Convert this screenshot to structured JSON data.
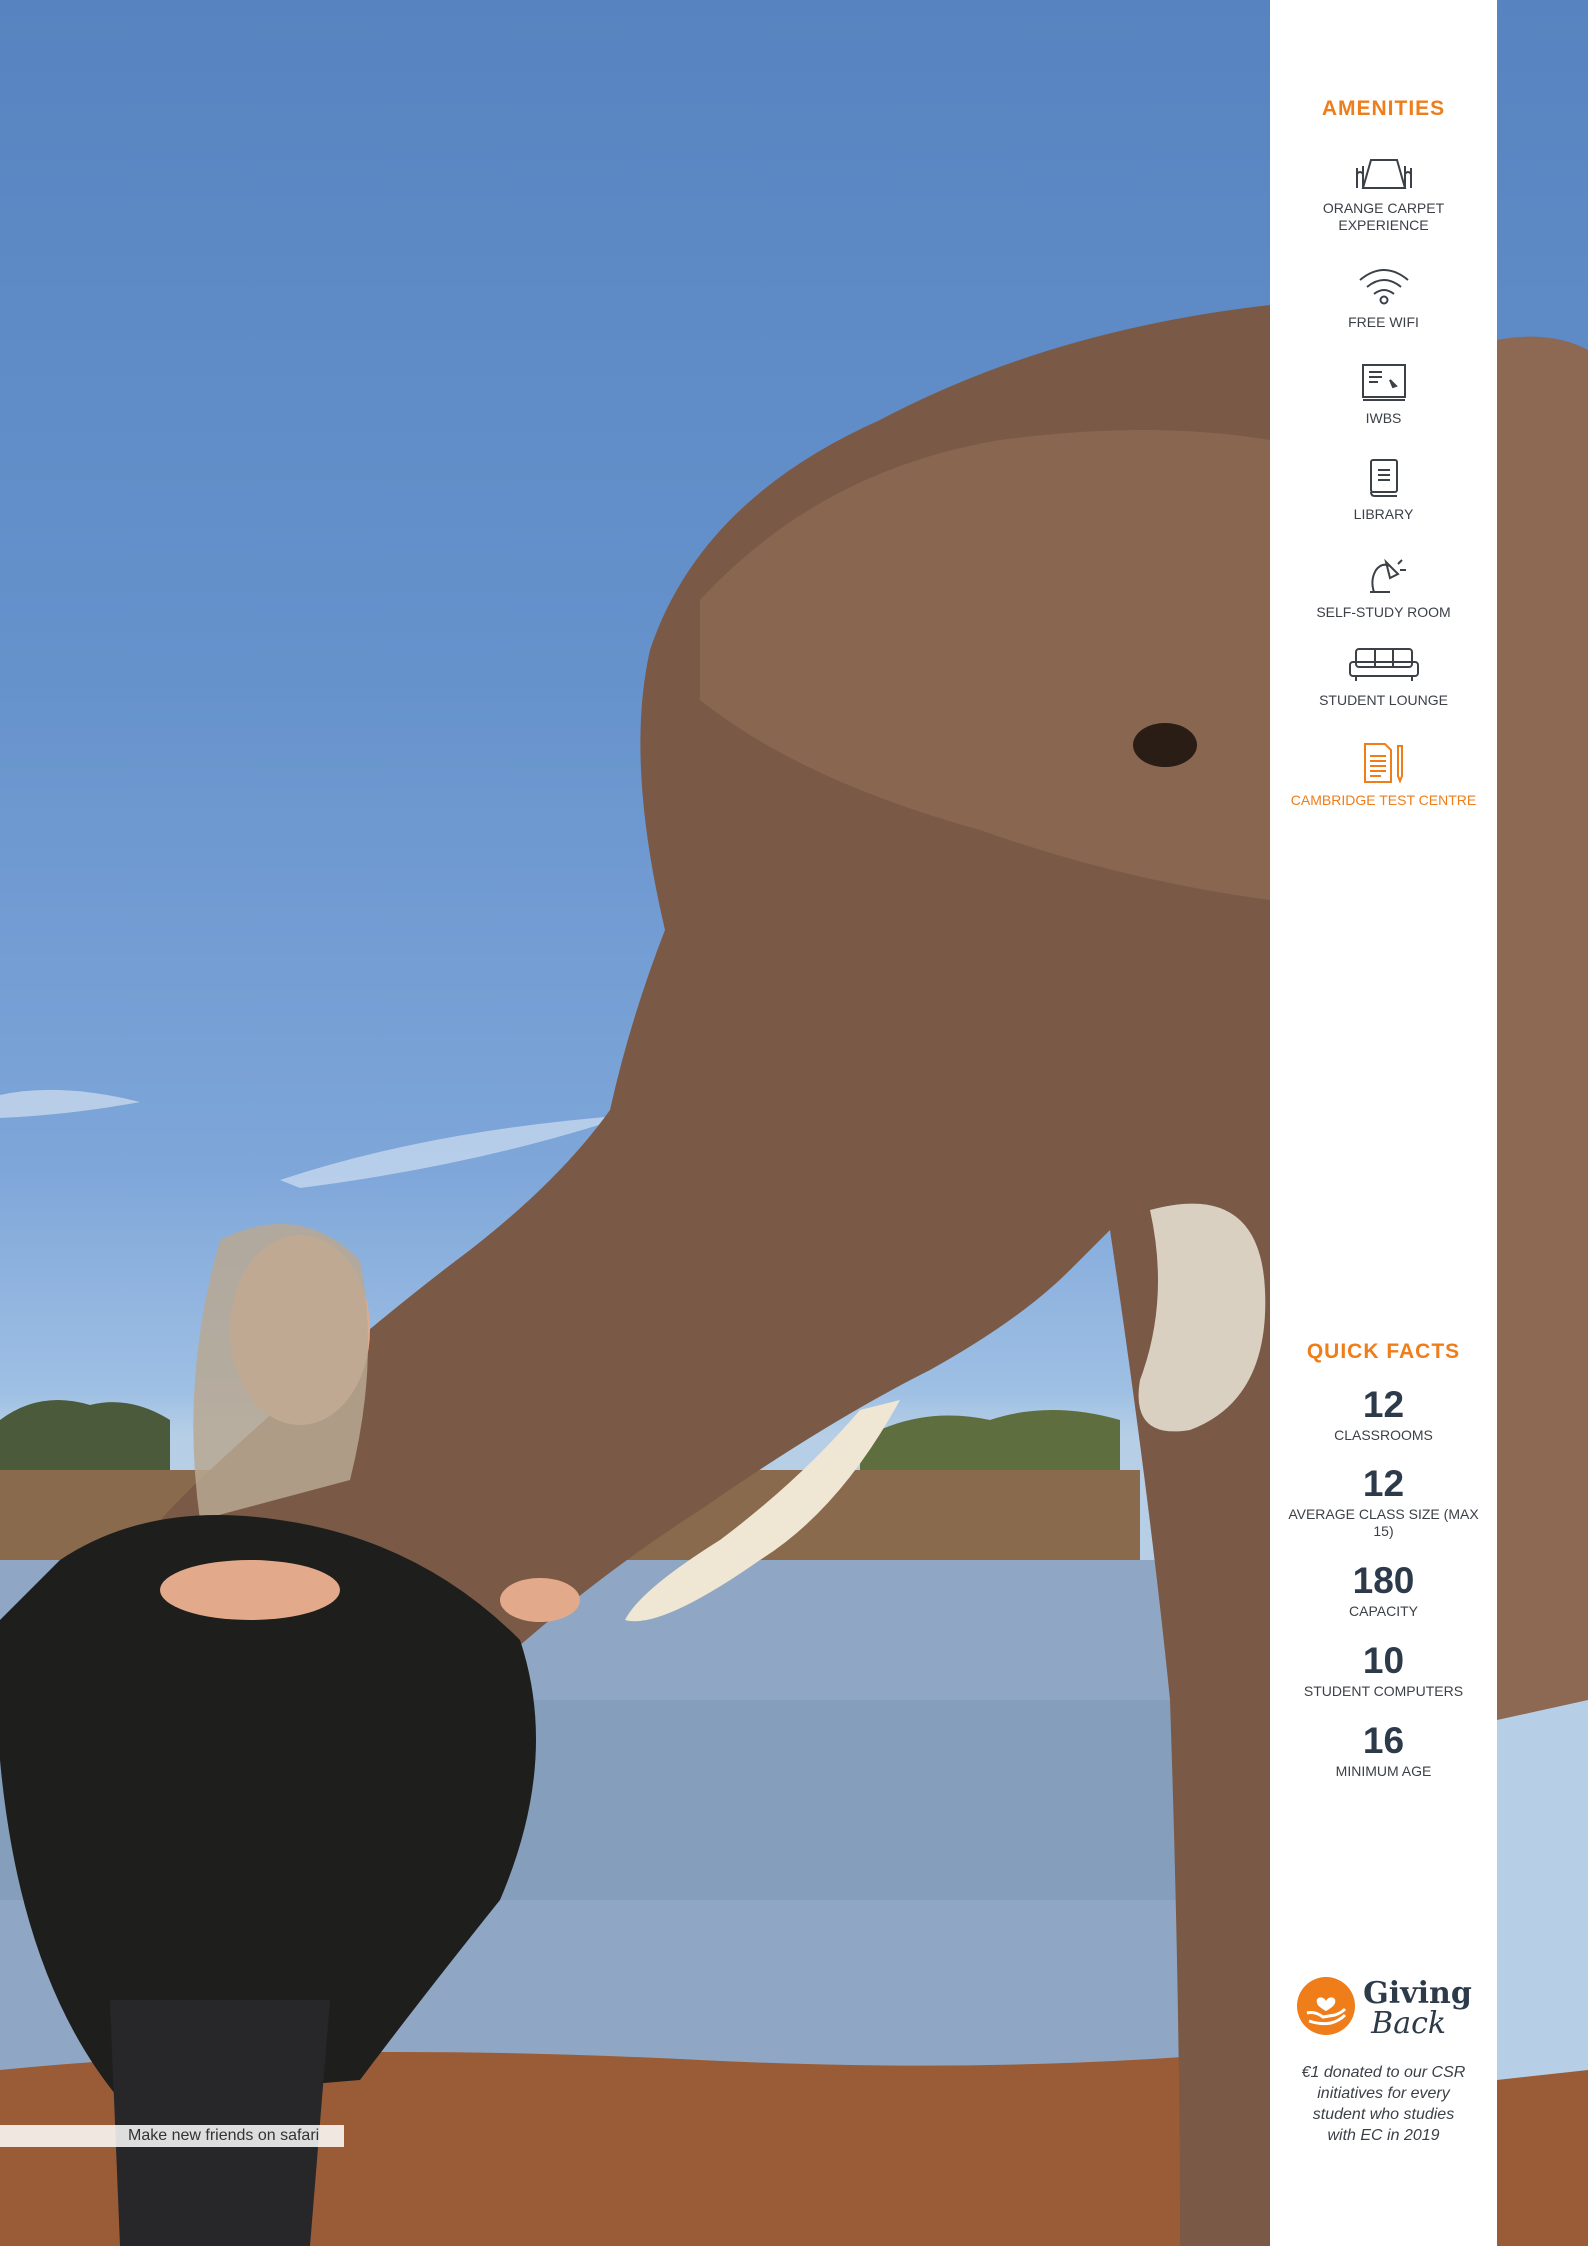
{
  "photo": {
    "subject": "elephant-and-woman-photo"
  },
  "caption": "Make new friends on safari",
  "amenities": {
    "title": "AMENITIES",
    "items": [
      {
        "label": "ORANGE CARPET EXPERIENCE",
        "icon": "orange-carpet-icon"
      },
      {
        "label": "FREE WIFI",
        "icon": "wifi-icon"
      },
      {
        "label": "IWBS",
        "icon": "whiteboard-icon"
      },
      {
        "label": "LIBRARY",
        "icon": "book-icon"
      },
      {
        "label": "SELF-STUDY ROOM",
        "icon": "desk-lamp-icon"
      },
      {
        "label": "STUDENT LOUNGE",
        "icon": "sofa-icon"
      },
      {
        "label": "CAMBRIDGE TEST CENTRE",
        "icon": "test-document-icon"
      }
    ]
  },
  "quick_facts": {
    "title": "QUICK FACTS",
    "items": [
      {
        "value": "12",
        "label": "CLASSROOMS"
      },
      {
        "value": "12",
        "label": "AVERAGE CLASS SIZE (MAX 15)"
      },
      {
        "value": "180",
        "label": "CAPACITY"
      },
      {
        "value": "10",
        "label": "STUDENT COMPUTERS"
      },
      {
        "value": "16",
        "label": "MINIMUM AGE"
      }
    ]
  },
  "giving_back": {
    "word1": "Giving",
    "word2": "Back",
    "note": "€1 donated to our CSR initiatives for every student who studies with EC in 2019"
  },
  "colors": {
    "accent": "#ee7d1a",
    "text": "#3c4047",
    "numbers": "#2d3a4a"
  }
}
